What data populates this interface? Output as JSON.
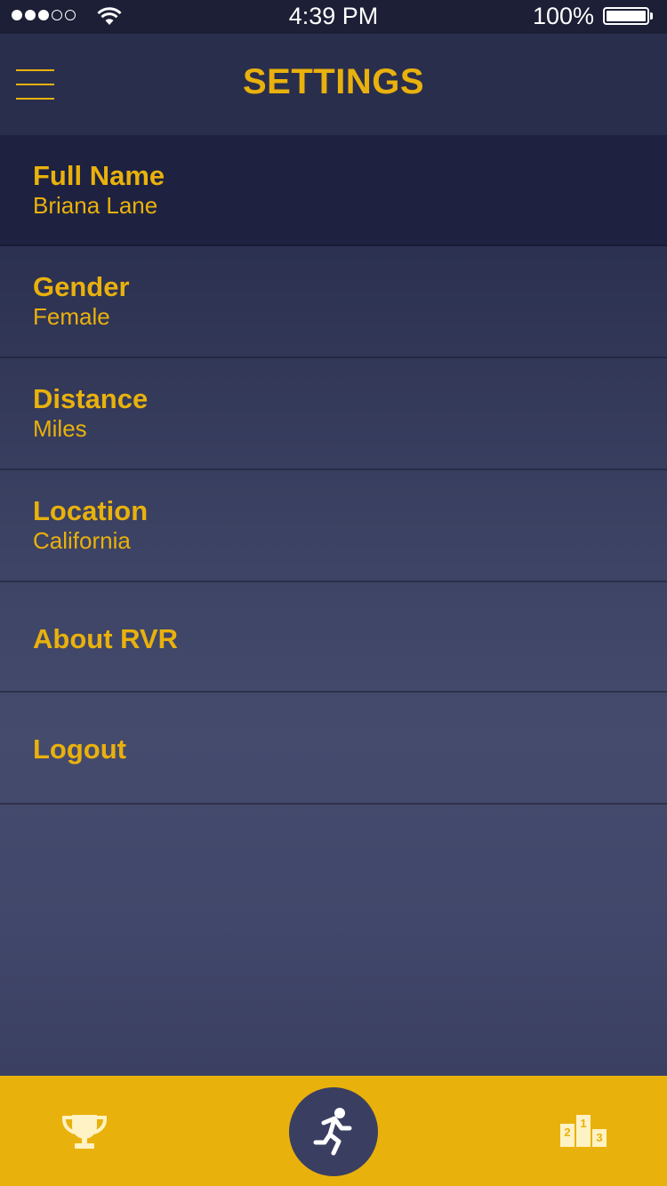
{
  "status_bar": {
    "time": "4:39 PM",
    "battery_percent": "100%",
    "signal_bars_filled": 3,
    "signal_bars_total": 5,
    "wifi_icon": "wifi-icon",
    "battery_level": 1.0
  },
  "nav": {
    "title": "SETTINGS",
    "menu_icon": "hamburger-menu-icon"
  },
  "settings": [
    {
      "label": "Full Name",
      "value": "Briana Lane"
    },
    {
      "label": "Gender",
      "value": "Female"
    },
    {
      "label": "Distance",
      "value": "Miles"
    },
    {
      "label": "Location",
      "value": "California"
    },
    {
      "label": "About RVR"
    },
    {
      "label": "Logout"
    }
  ],
  "tab_bar": {
    "tabs": [
      {
        "icon": "trophy-icon"
      },
      {
        "icon": "running-man-icon",
        "active": true
      },
      {
        "icon": "leaderboard-podium-icon",
        "podium_numbers": [
          "2",
          "1",
          "3"
        ]
      }
    ]
  },
  "colors": {
    "accent": "#e9b10c",
    "nav_background": "#2a2e4d",
    "status_bar_background": "#1c1f35",
    "run_button_background": "#3a3f62"
  }
}
